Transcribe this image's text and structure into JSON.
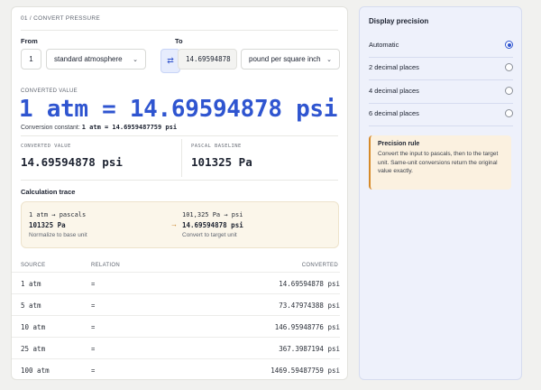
{
  "header": {
    "eyebrow": "01 / CONVERT PRESSURE"
  },
  "form": {
    "from_label": "From",
    "to_label": "To",
    "from_value": "1",
    "from_unit": "standard atmosphere",
    "to_value": "14.69594878",
    "to_unit": "pound per square inch",
    "swap_icon": "swap-arrows-icon"
  },
  "result": {
    "label": "CONVERTED VALUE",
    "headline": "1 atm = 14.69594878 psi",
    "constant_prefix": "Conversion constant:",
    "constant_value": "1 atm = 14.6959487759 psi"
  },
  "stats": {
    "converted_label": "CONVERTED VALUE",
    "converted_value": "14.69594878 psi",
    "pascal_label": "PASCAL BASELINE",
    "pascal_value": "101325 Pa"
  },
  "trace": {
    "title": "Calculation trace",
    "step1_expr": "1 atm → pascals",
    "step1_result": "101325 Pa",
    "step1_note": "Normalize to base unit",
    "arrow": "→",
    "step2_expr": "101,325 Pa → psi",
    "step2_result": "14.69594878 psi",
    "step2_note": "Convert to target unit"
  },
  "table": {
    "headers": [
      "SOURCE",
      "RELATION",
      "CONVERTED"
    ],
    "rows": [
      {
        "source": "1 atm",
        "relation": "=",
        "converted": "14.69594878 psi"
      },
      {
        "source": "5 atm",
        "relation": "=",
        "converted": "73.47974388 psi"
      },
      {
        "source": "10 atm",
        "relation": "=",
        "converted": "146.95948776 psi"
      },
      {
        "source": "25 atm",
        "relation": "=",
        "converted": "367.3987194 psi"
      },
      {
        "source": "100 atm",
        "relation": "=",
        "converted": "1469.59487759 psi"
      }
    ]
  },
  "precision": {
    "title": "Display precision",
    "options": [
      {
        "label": "Automatic",
        "selected": true
      },
      {
        "label": "2 decimal places",
        "selected": false
      },
      {
        "label": "4 decimal places",
        "selected": false
      },
      {
        "label": "6 decimal places",
        "selected": false
      }
    ]
  },
  "note": {
    "title": "Precision rule",
    "body": "Convert the input to pascals, then to the target unit. Same-unit conversions return the original value exactly."
  },
  "colors": {
    "accent": "#2f55d0",
    "note_accent": "#d68a2a"
  }
}
